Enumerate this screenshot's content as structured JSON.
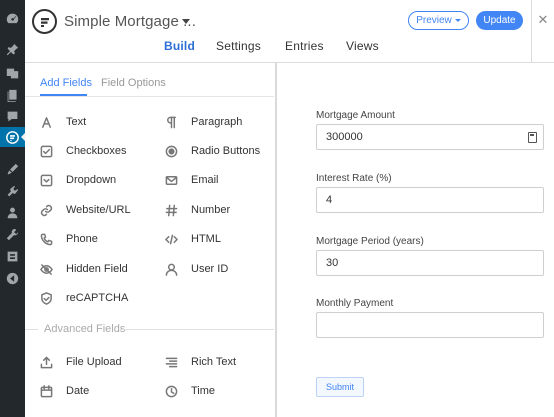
{
  "header": {
    "form_title": "Simple Mortgage ...",
    "preview_label": "Preview",
    "update_label": "Update",
    "close_glyph": "✕",
    "tabs": [
      {
        "label": "Build"
      },
      {
        "label": "Settings"
      },
      {
        "label": "Entries"
      },
      {
        "label": "Views"
      }
    ],
    "active_tab": "Build"
  },
  "left_panel": {
    "sub_tabs": [
      {
        "label": "Add Fields"
      },
      {
        "label": "Field Options"
      }
    ],
    "fields": [
      {
        "label": "Text",
        "icon": "text-icon"
      },
      {
        "label": "Paragraph",
        "icon": "paragraph-icon"
      },
      {
        "label": "Checkboxes",
        "icon": "checkbox-icon"
      },
      {
        "label": "Radio Buttons",
        "icon": "radio-icon"
      },
      {
        "label": "Dropdown",
        "icon": "dropdown-icon"
      },
      {
        "label": "Email",
        "icon": "email-icon"
      },
      {
        "label": "Website/URL",
        "icon": "link-icon"
      },
      {
        "label": "Number",
        "icon": "hash-icon"
      },
      {
        "label": "Phone",
        "icon": "phone-icon"
      },
      {
        "label": "HTML",
        "icon": "code-icon"
      },
      {
        "label": "Hidden Field",
        "icon": "eye-slash-icon"
      },
      {
        "label": "User ID",
        "icon": "user-icon"
      },
      {
        "label": "reCAPTCHA",
        "icon": "shield-icon"
      }
    ],
    "advanced_label": "Advanced Fields",
    "advanced_fields": [
      {
        "label": "File Upload",
        "icon": "upload-icon"
      },
      {
        "label": "Rich Text",
        "icon": "align-icon"
      },
      {
        "label": "Date",
        "icon": "calendar-icon"
      },
      {
        "label": "Time",
        "icon": "clock-icon"
      }
    ]
  },
  "preview": {
    "fields": [
      {
        "label": "Mortgage Amount",
        "value": "300000"
      },
      {
        "label": "Interest Rate (%)",
        "value": "4"
      },
      {
        "label": "Mortgage Period (years)",
        "value": "30"
      },
      {
        "label": "Monthly Payment",
        "value": ""
      }
    ],
    "submit_label": "Submit"
  },
  "colors": {
    "accent": "#4285f4",
    "admin_bar": "#23282d",
    "admin_active": "#0073aa"
  }
}
